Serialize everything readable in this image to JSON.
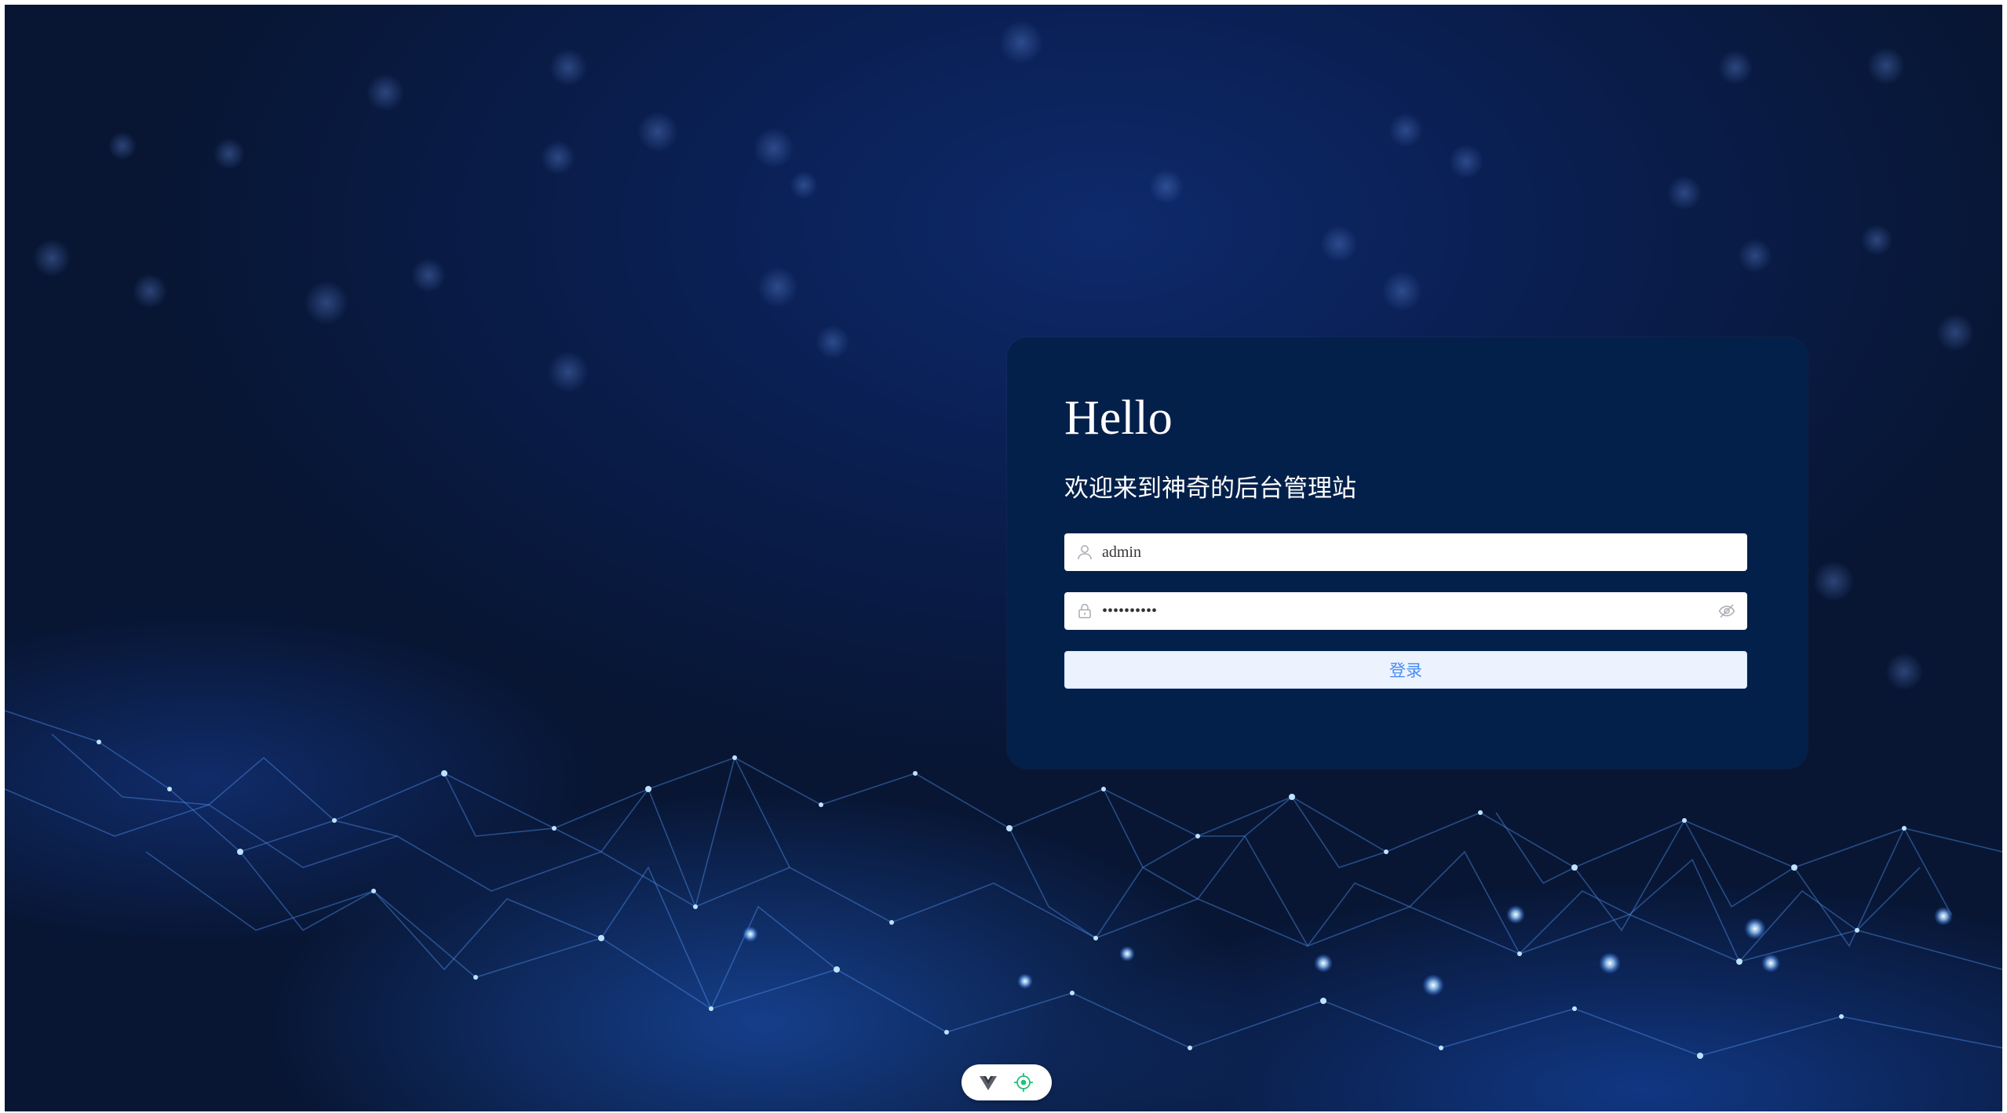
{
  "login": {
    "greeting": "Hello",
    "subtitle": "欢迎来到神奇的后台管理站",
    "username": {
      "value": "admin",
      "icon": "user-icon"
    },
    "password": {
      "value": "••••••••••",
      "icon": "lock-icon",
      "toggle_icon": "eye-slash-icon"
    },
    "submit_label": "登录"
  },
  "devtools_bar": {
    "icons": [
      "vue-logo-icon",
      "inspect-target-icon"
    ]
  },
  "colors": {
    "card_background": "#03204a",
    "button_background": "#ecf3ff",
    "button_text": "#4a8cf5",
    "inspect_icon": "#22c07a"
  }
}
